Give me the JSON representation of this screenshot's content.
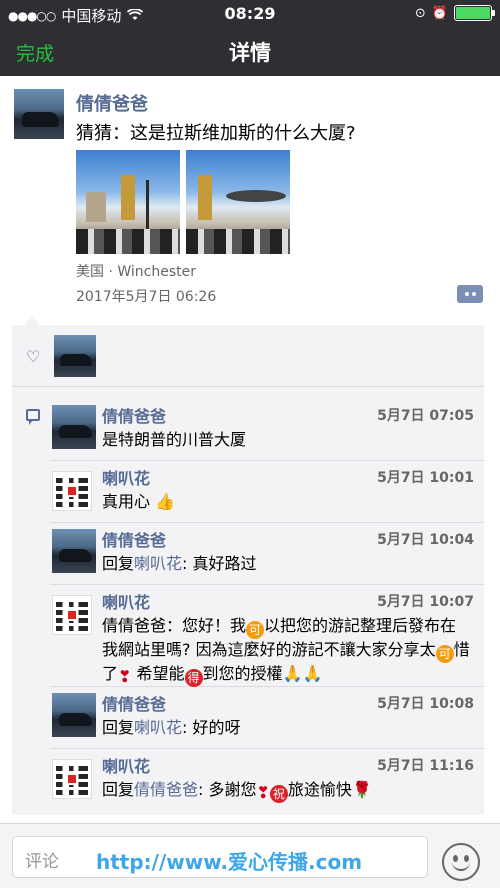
{
  "status": {
    "carrier": "中国移动",
    "time": "08:29"
  },
  "nav": {
    "back_label": "完成",
    "title": "详情"
  },
  "post": {
    "author": "倩倩爸爸",
    "text": "猜猜：这是拉斯维加斯的什么大厦?",
    "location": "美国 · Winchester",
    "time": "2017年5月7日 06:26"
  },
  "comments": [
    {
      "name": "倩倩爸爸",
      "time": "5月7日 07:05",
      "avatar": "car",
      "text": "是特朗普的川普大厦"
    },
    {
      "name": "喇叭花",
      "time": "5月7日 10:01",
      "avatar": "qr",
      "text": "真用心"
    },
    {
      "name": "倩倩爸爸",
      "time": "5月7日 10:04",
      "avatar": "car",
      "reply_prefix": "回复",
      "reply_to": "喇叭花",
      "text": ": 真好路过"
    },
    {
      "name": "喇叭花",
      "time": "5月7日 10:07",
      "avatar": "qr",
      "t1": "倩倩爸爸：您好！我",
      "e1": "可",
      "t2": "以把您的游記整理后發布在我網站里嗎? 因為這麼好的游記不讓大家分享太",
      "e2": "可",
      "t3": "惜了",
      "t4": "希望能",
      "e3": "得",
      "t5": "到您的授權"
    },
    {
      "name": "倩倩爸爸",
      "time": "5月7日 10:08",
      "avatar": "car",
      "reply_prefix": "回复",
      "reply_to": "喇叭花",
      "text": ": 好的呀"
    },
    {
      "name": "喇叭花",
      "time": "5月7日 11:16",
      "avatar": "qr",
      "reply_prefix": "回复",
      "reply_to": "倩倩爸爸",
      "t1": ": 多謝您",
      "e1": "祝",
      "t2": "旅途愉快"
    }
  ],
  "composer": {
    "placeholder": "评论",
    "watermark": "http://www.爱心传播.com"
  },
  "colors": {
    "nav_bg": "#2f2f33",
    "accent_green": "#23c03a",
    "link_blue": "#576b95"
  }
}
